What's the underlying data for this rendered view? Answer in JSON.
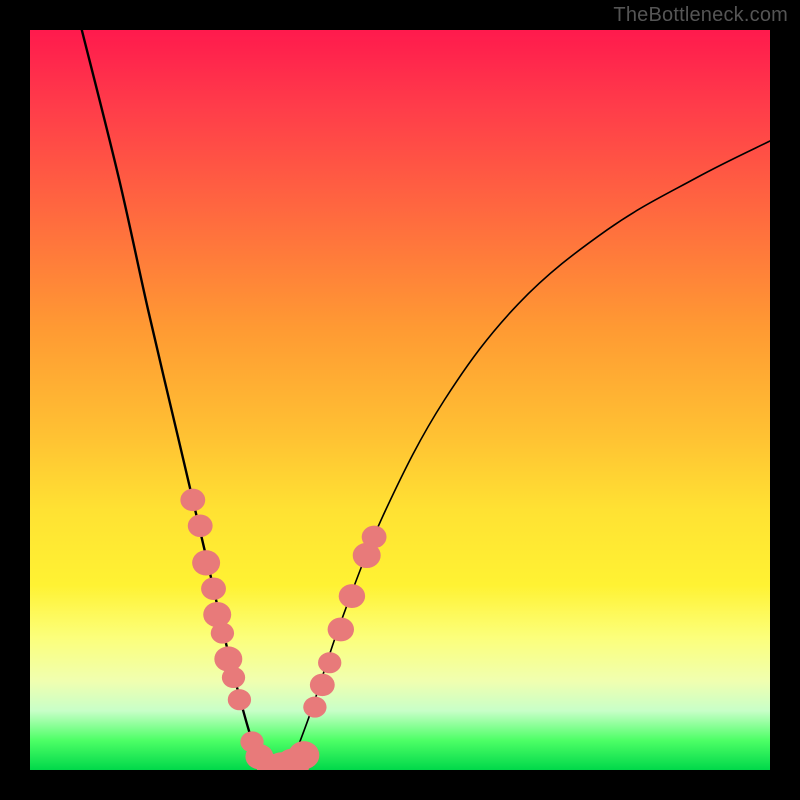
{
  "watermark": "TheBottleneck.com",
  "chart_data": {
    "type": "line",
    "title": "",
    "xlabel": "",
    "ylabel": "",
    "xlim": [
      0,
      100
    ],
    "ylim": [
      0,
      100
    ],
    "curve": {
      "name": "bottleneck-curve",
      "left_branch": [
        {
          "x": 7,
          "y": 100
        },
        {
          "x": 12,
          "y": 80
        },
        {
          "x": 16,
          "y": 62
        },
        {
          "x": 20,
          "y": 45
        },
        {
          "x": 24,
          "y": 28
        },
        {
          "x": 27,
          "y": 15
        },
        {
          "x": 30,
          "y": 4
        },
        {
          "x": 32,
          "y": 0
        }
      ],
      "right_branch": [
        {
          "x": 35,
          "y": 0
        },
        {
          "x": 38,
          "y": 8
        },
        {
          "x": 42,
          "y": 20
        },
        {
          "x": 48,
          "y": 35
        },
        {
          "x": 56,
          "y": 50
        },
        {
          "x": 66,
          "y": 63
        },
        {
          "x": 78,
          "y": 73
        },
        {
          "x": 90,
          "y": 80
        },
        {
          "x": 100,
          "y": 85
        }
      ]
    },
    "scatter": {
      "name": "sample-points",
      "color": "#e87a7a",
      "points": [
        {
          "x": 22.0,
          "y": 36.5,
          "r": 1.6
        },
        {
          "x": 23.0,
          "y": 33.0,
          "r": 1.6
        },
        {
          "x": 23.8,
          "y": 28.0,
          "r": 1.8
        },
        {
          "x": 24.8,
          "y": 24.5,
          "r": 1.6
        },
        {
          "x": 25.3,
          "y": 21.0,
          "r": 1.8
        },
        {
          "x": 26.0,
          "y": 18.5,
          "r": 1.5
        },
        {
          "x": 26.8,
          "y": 15.0,
          "r": 1.8
        },
        {
          "x": 27.5,
          "y": 12.5,
          "r": 1.5
        },
        {
          "x": 28.3,
          "y": 9.5,
          "r": 1.5
        },
        {
          "x": 30.0,
          "y": 3.8,
          "r": 1.5
        },
        {
          "x": 31.0,
          "y": 1.8,
          "r": 1.8
        },
        {
          "x": 32.5,
          "y": 0.5,
          "r": 1.8
        },
        {
          "x": 34.0,
          "y": 0.5,
          "r": 2.0
        },
        {
          "x": 35.5,
          "y": 0.8,
          "r": 2.2
        },
        {
          "x": 37.0,
          "y": 2.0,
          "r": 2.0
        },
        {
          "x": 38.5,
          "y": 8.5,
          "r": 1.5
        },
        {
          "x": 39.5,
          "y": 11.5,
          "r": 1.6
        },
        {
          "x": 40.5,
          "y": 14.5,
          "r": 1.5
        },
        {
          "x": 42.0,
          "y": 19.0,
          "r": 1.7
        },
        {
          "x": 43.5,
          "y": 23.5,
          "r": 1.7
        },
        {
          "x": 45.5,
          "y": 29.0,
          "r": 1.8
        },
        {
          "x": 46.5,
          "y": 31.5,
          "r": 1.6
        }
      ]
    }
  }
}
